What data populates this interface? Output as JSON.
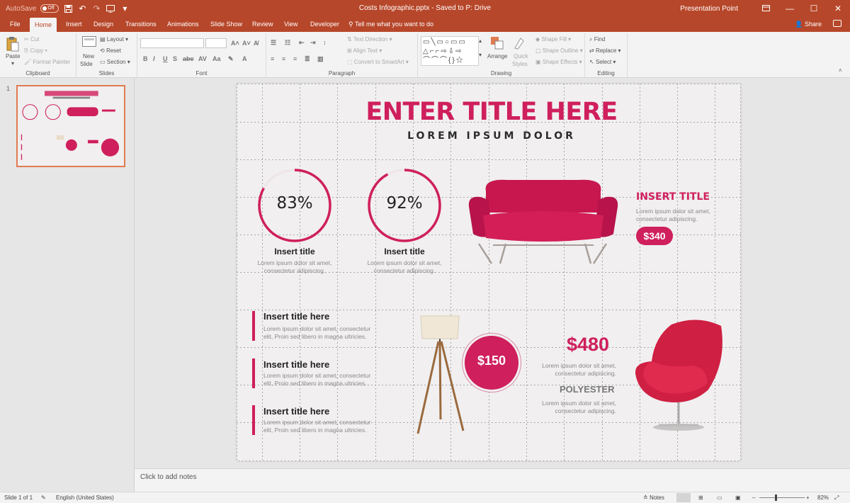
{
  "titlebar": {
    "autosave_label": "AutoSave",
    "autosave_state": "Off",
    "document_title": "Costs Infographic.pptx - Saved to P: Drive",
    "user": "Presentation Point"
  },
  "tabs": [
    {
      "label": "File"
    },
    {
      "label": "Home"
    },
    {
      "label": "Insert"
    },
    {
      "label": "Design"
    },
    {
      "label": "Transitions"
    },
    {
      "label": "Animations"
    },
    {
      "label": "Slide Show"
    },
    {
      "label": "Review"
    },
    {
      "label": "View"
    },
    {
      "label": "Developer"
    }
  ],
  "tell_me": "Tell me what you want to do",
  "share_label": "Share",
  "ribbon": {
    "clipboard": {
      "paste": "Paste",
      "cut": "Cut",
      "copy": "Copy",
      "format_painter": "Format Painter",
      "label": "Clipboard"
    },
    "slides": {
      "new_slide": "New",
      "new_slide2": "Slide",
      "layout": "Layout",
      "reset": "Reset",
      "section": "Section",
      "label": "Slides"
    },
    "font": {
      "label": "Font"
    },
    "paragraph": {
      "text_direction": "Text Direction",
      "align_text": "Align Text",
      "convert": "Convert to SmartArt",
      "label": "Paragraph"
    },
    "drawing": {
      "arrange": "Arrange",
      "quick_styles": "Quick",
      "quick_styles2": "Styles",
      "shape_fill": "Shape Fill",
      "shape_outline": "Shape Outline",
      "shape_effects": "Shape Effects",
      "label": "Drawing"
    },
    "editing": {
      "find": "Find",
      "replace": "Replace",
      "select": "Select",
      "label": "Editing"
    }
  },
  "thumbnail": {
    "number": "1"
  },
  "slide": {
    "title": "ENTER TITLE HERE",
    "subtitle": "LOREM IPSUM DOLOR",
    "stats": [
      {
        "percent_label": "83%",
        "value": 83,
        "title": "Insert title",
        "text1": "Lorem ipsum dolor sit amet,",
        "text2": "consectetur adipiscing."
      },
      {
        "percent_label": "92%",
        "value": 92,
        "title": "Insert title",
        "text1": "Lorem ipsum dolor sit amet,",
        "text2": "consectetur adipiscing."
      }
    ],
    "sofa": {
      "title": "INSERT TITLE",
      "text1": "Lorem ipsum dolor sit amet,",
      "text2": "consectetur adipiscing.",
      "price": "$340"
    },
    "list": [
      {
        "title": "Insert title here",
        "text1": "Lorem ipsum dolor sit amet, consectetur",
        "text2": "elit, Proin sed libero in magna ultricies."
      },
      {
        "title": "Insert title here",
        "text1": "Lorem ipsum dolor sit amet, consectetur",
        "text2": "elit, Proin sed libero in magna ultricies."
      },
      {
        "title": "Insert title here",
        "text1": "Lorem ipsum dolor sit amet, consectetur",
        "text2": "elit, Proin sed libero in magna ultricies."
      }
    ],
    "lamp_price": "$150",
    "chair": {
      "price": "$480",
      "text1": "Lorem ipsum dolor sit amet,",
      "text2": "consectetur adipiscing.",
      "material": "POLYESTER",
      "text3": "Lorem ipsum dolor sit amet,",
      "text4": "consectetur adipiscing."
    }
  },
  "notes_placeholder": "Click to add notes",
  "status": {
    "slide": "Slide 1 of 1",
    "language": "English (United States)",
    "notes": "Notes",
    "zoom": "82%"
  },
  "colors": {
    "accent": "#cf1f5c",
    "titlebar": "#b7472a"
  }
}
